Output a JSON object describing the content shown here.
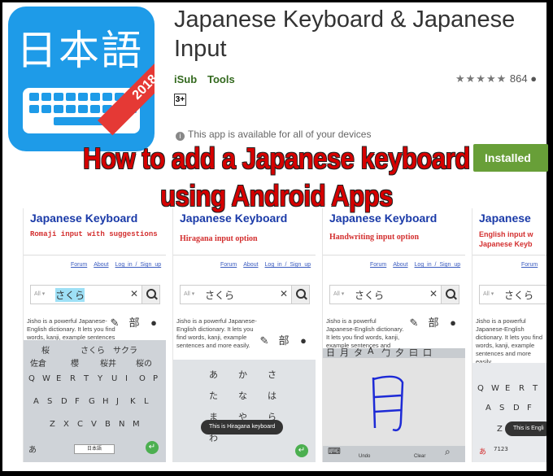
{
  "app": {
    "icon_kanji": "日本語",
    "icon_year": "2018",
    "title": "Japanese Keyboard & Japanese Input",
    "developer": "iSub",
    "category": "Tools",
    "rating_stars": "★★★★★",
    "rating_count": "864",
    "age_rating": "3+",
    "availability": "This app is available for all of your devices",
    "install_label": "Installed"
  },
  "headline": {
    "line1": "How to add a Japanese keyboard",
    "line2": "using Android Apps"
  },
  "colors": {
    "accent_green": "#689f38",
    "headline_red": "#d60000",
    "icon_blue": "#1e9be8"
  },
  "screenshots": [
    {
      "heading": "Japanese Keyboard",
      "subheading": "Romaji input with suggestions",
      "links": [
        "Forum",
        "About",
        "Log in / Sign up"
      ],
      "search_all": "All ▾",
      "search_value": "さくら",
      "body": "Jisho is a powerful Japanese-English dictionary. It lets you find words, kanji, example sentences and more",
      "tools": [
        "Draw",
        "Radicals",
        "Voice"
      ],
      "suggest1": [
        "桜",
        "さくら",
        "サクラ"
      ],
      "suggest2": [
        "佐倉",
        "櫻",
        "桜井",
        "桜の"
      ],
      "keys1": [
        "Q",
        "W",
        "E",
        "R",
        "T",
        "Y",
        "U",
        "I",
        "O",
        "P"
      ],
      "keys2": [
        "A",
        "S",
        "D",
        "F",
        "G",
        "H",
        "J",
        "K",
        "L"
      ],
      "keys3": [
        "Z",
        "X",
        "C",
        "V",
        "B",
        "N",
        "M"
      ],
      "bottom_left": "あ",
      "space": "日本語"
    },
    {
      "heading": "Japanese Keyboard",
      "subheading": "Hiragana input option",
      "links": [
        "Forum",
        "About",
        "Log in / Sign up"
      ],
      "search_all": "All ▾",
      "search_value": "さくら",
      "body": "Jisho is a powerful Japanese-English dictionary. It lets you find words, kanji, example sentences and more easily.",
      "tools": [
        "Draw",
        "Radicals",
        "Voice"
      ],
      "kana": [
        "あ",
        "か",
        "さ",
        "た",
        "な",
        "は",
        "ま",
        "や",
        "ら",
        "わ"
      ],
      "toast": "This is Hiragana keyboard"
    },
    {
      "heading": "Japanese Keyboard",
      "subheading": "Handwriting input option",
      "links": [
        "Forum",
        "About",
        "Log in / Sign up"
      ],
      "search_all": "All ▾",
      "search_value": "さくら",
      "body": "Jisho is a powerful Japanese-English dictionary. It lets you find words, kanji, example sentences and more easily.",
      "tools": [
        "Draw",
        "Radicals",
        "Voice"
      ],
      "candidates": [
        "日",
        "月",
        "タ",
        "A",
        "勹",
        "夕",
        "曰",
        "口"
      ],
      "drawn": "月",
      "bottom": [
        "Undo",
        "Clear"
      ]
    },
    {
      "heading": "Japanese",
      "subheading": "English input w",
      "subheading2": "Japanese Keyb",
      "links": [
        "Forum"
      ],
      "search_all": "All ▾",
      "search_value": "さくら",
      "body": "Jisho is a powerful Japanese-English dictionary. It lets you find words, kanji, example sentences and more easily.",
      "keys1": [
        "Q",
        "W",
        "E",
        "R",
        "T"
      ],
      "keys2": [
        "A",
        "S",
        "D",
        "F"
      ],
      "keys3": [
        "Z",
        "X",
        "C"
      ],
      "toast": "This is Engli",
      "bottom_left": "あ",
      "num": "7123"
    }
  ]
}
